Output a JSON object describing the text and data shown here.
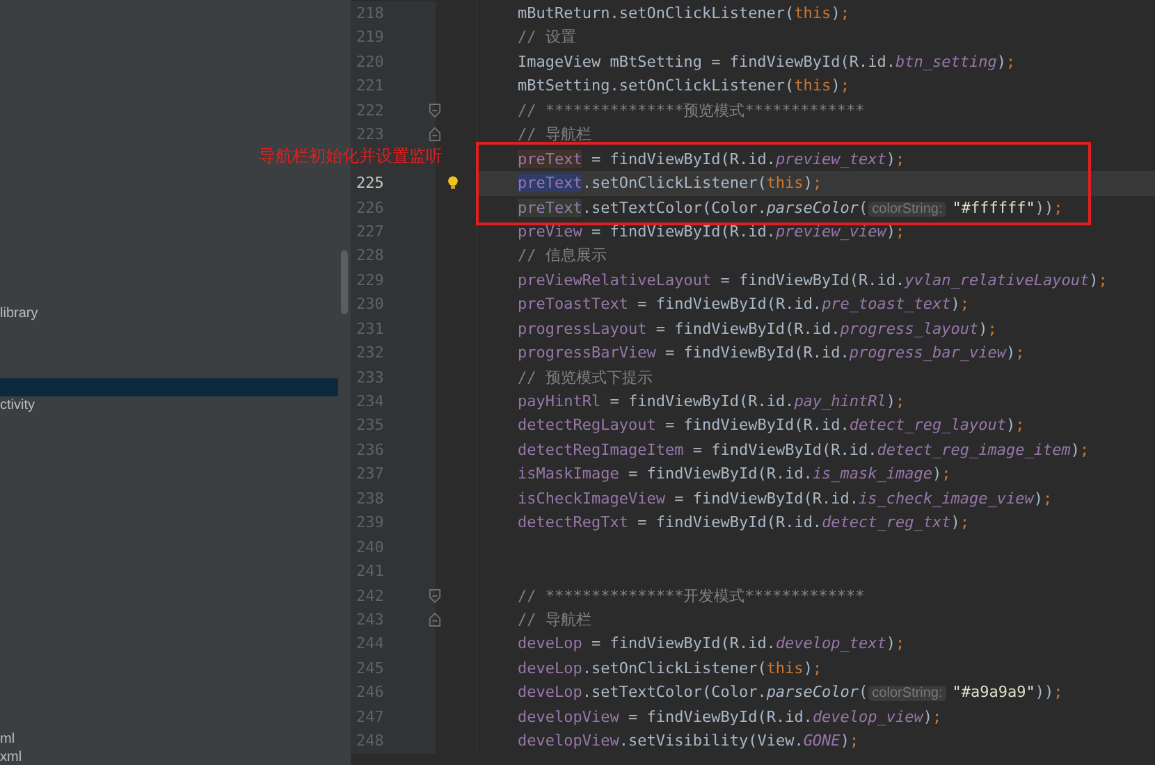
{
  "sidebar": {
    "items": [
      {
        "text": "library",
        "selected": false
      },
      {
        "selected": true
      },
      {
        "text": "ctivity",
        "selected": false
      },
      {
        "text": "ml",
        "selected": false
      },
      {
        "text": "xml",
        "selected": false
      }
    ]
  },
  "editor": {
    "lines": [
      {
        "number": "218",
        "current": false,
        "tokens": [
          {
            "kind": "plain",
            "text": "mButReturn.setOnClickListener("
          },
          {
            "kind": "keyword",
            "text": "this"
          },
          {
            "kind": "plain",
            "text": ")"
          },
          {
            "kind": "keyword",
            "text": ";"
          }
        ]
      },
      {
        "number": "219",
        "current": false,
        "tokens": [
          {
            "kind": "comment",
            "text": "// 设置"
          }
        ]
      },
      {
        "number": "220",
        "current": false,
        "tokens": [
          {
            "kind": "plain",
            "text": "ImageView mBtSetting = findViewById(R.id."
          },
          {
            "kind": "id",
            "text": "btn_setting"
          },
          {
            "kind": "plain",
            "text": ")"
          },
          {
            "kind": "keyword",
            "text": ";"
          }
        ]
      },
      {
        "number": "221",
        "current": false,
        "tokens": [
          {
            "kind": "plain",
            "text": "mBtSetting.setOnClickListener("
          },
          {
            "kind": "keyword",
            "text": "this"
          },
          {
            "kind": "plain",
            "text": ")"
          },
          {
            "kind": "keyword",
            "text": ";"
          }
        ]
      },
      {
        "number": "222",
        "current": false,
        "gutter": [
          {
            "kind": "fold_start"
          }
        ],
        "tokens": [
          {
            "kind": "comment",
            "text": "// ***************预览模式*************"
          }
        ]
      },
      {
        "number": "223",
        "current": false,
        "gutter": [
          {
            "kind": "fold_end"
          }
        ],
        "tokens": [
          {
            "kind": "comment",
            "text": "// 导航栏"
          }
        ]
      },
      {
        "current": false,
        "tokens": [
          {
            "kind": "field_write",
            "text": "preText"
          },
          {
            "kind": "plain",
            "text": " = findViewById(R.id."
          },
          {
            "kind": "id",
            "text": "preview_text"
          },
          {
            "kind": "plain",
            "text": ")"
          },
          {
            "kind": "keyword",
            "text": ";"
          }
        ]
      },
      {
        "number": "225",
        "current": true,
        "gutter": [
          {
            "kind": "bulb"
          }
        ],
        "tokens": [
          {
            "kind": "field_caret",
            "text": "preText"
          },
          {
            "kind": "plain",
            "text": ".setOnClickListener("
          },
          {
            "kind": "keyword",
            "text": "this"
          },
          {
            "kind": "plain",
            "text": ")"
          },
          {
            "kind": "keyword",
            "text": ";"
          }
        ]
      },
      {
        "number": "226",
        "current": false,
        "tokens": [
          {
            "kind": "field_read",
            "text": "preText"
          },
          {
            "kind": "plain",
            "text": ".setTextColor(Color."
          },
          {
            "kind": "method",
            "text": "parseColor"
          },
          {
            "kind": "plain",
            "text": "("
          },
          {
            "kind": "hint",
            "text": "colorString:"
          },
          {
            "kind": "string",
            "text": "\"#ffffff\""
          },
          {
            "kind": "plain",
            "text": "))"
          },
          {
            "kind": "keyword",
            "text": ";"
          }
        ]
      },
      {
        "number": "227",
        "current": false,
        "tokens": [
          {
            "kind": "field",
            "text": "preView"
          },
          {
            "kind": "plain",
            "text": " = findViewById(R.id."
          },
          {
            "kind": "id",
            "text": "preview_view"
          },
          {
            "kind": "plain",
            "text": ")"
          },
          {
            "kind": "keyword",
            "text": ";"
          }
        ]
      },
      {
        "number": "228",
        "current": false,
        "tokens": [
          {
            "kind": "comment",
            "text": "// 信息展示"
          }
        ]
      },
      {
        "number": "229",
        "current": false,
        "tokens": [
          {
            "kind": "field",
            "text": "preViewRelativeLayout"
          },
          {
            "kind": "plain",
            "text": " = findViewById(R.id."
          },
          {
            "kind": "id",
            "text": "yvlan_relativeLayout"
          },
          {
            "kind": "plain",
            "text": ")"
          },
          {
            "kind": "keyword",
            "text": ";"
          }
        ]
      },
      {
        "number": "230",
        "current": false,
        "tokens": [
          {
            "kind": "field",
            "text": "preToastText"
          },
          {
            "kind": "plain",
            "text": " = findViewById(R.id."
          },
          {
            "kind": "id",
            "text": "pre_toast_text"
          },
          {
            "kind": "plain",
            "text": ")"
          },
          {
            "kind": "keyword",
            "text": ";"
          }
        ]
      },
      {
        "number": "231",
        "current": false,
        "tokens": [
          {
            "kind": "field",
            "text": "progressLayout"
          },
          {
            "kind": "plain",
            "text": " = findViewById(R.id."
          },
          {
            "kind": "id",
            "text": "progress_layout"
          },
          {
            "kind": "plain",
            "text": ")"
          },
          {
            "kind": "keyword",
            "text": ";"
          }
        ]
      },
      {
        "number": "232",
        "current": false,
        "tokens": [
          {
            "kind": "field",
            "text": "progressBarView"
          },
          {
            "kind": "plain",
            "text": " = findViewById(R.id."
          },
          {
            "kind": "id",
            "text": "progress_bar_view"
          },
          {
            "kind": "plain",
            "text": ")"
          },
          {
            "kind": "keyword",
            "text": ";"
          }
        ]
      },
      {
        "number": "233",
        "current": false,
        "tokens": [
          {
            "kind": "comment",
            "text": "// 预览模式下提示"
          }
        ]
      },
      {
        "number": "234",
        "current": false,
        "tokens": [
          {
            "kind": "field",
            "text": "payHintRl"
          },
          {
            "kind": "plain",
            "text": " = findViewById(R.id."
          },
          {
            "kind": "id",
            "text": "pay_hintRl"
          },
          {
            "kind": "plain",
            "text": ")"
          },
          {
            "kind": "keyword",
            "text": ";"
          }
        ]
      },
      {
        "number": "235",
        "current": false,
        "tokens": [
          {
            "kind": "field",
            "text": "detectRegLayout"
          },
          {
            "kind": "plain",
            "text": " = findViewById(R.id."
          },
          {
            "kind": "id",
            "text": "detect_reg_layout"
          },
          {
            "kind": "plain",
            "text": ")"
          },
          {
            "kind": "keyword",
            "text": ";"
          }
        ]
      },
      {
        "number": "236",
        "current": false,
        "tokens": [
          {
            "kind": "field",
            "text": "detectRegImageItem"
          },
          {
            "kind": "plain",
            "text": " = findViewById(R.id."
          },
          {
            "kind": "id",
            "text": "detect_reg_image_item"
          },
          {
            "kind": "plain",
            "text": ")"
          },
          {
            "kind": "keyword",
            "text": ";"
          }
        ]
      },
      {
        "number": "237",
        "current": false,
        "tokens": [
          {
            "kind": "field",
            "text": "isMaskImage"
          },
          {
            "kind": "plain",
            "text": " = findViewById(R.id."
          },
          {
            "kind": "id",
            "text": "is_mask_image"
          },
          {
            "kind": "plain",
            "text": ")"
          },
          {
            "kind": "keyword",
            "text": ";"
          }
        ]
      },
      {
        "number": "238",
        "current": false,
        "tokens": [
          {
            "kind": "field",
            "text": "isCheckImageView"
          },
          {
            "kind": "plain",
            "text": " = findViewById(R.id."
          },
          {
            "kind": "id",
            "text": "is_check_image_view"
          },
          {
            "kind": "plain",
            "text": ")"
          },
          {
            "kind": "keyword",
            "text": ";"
          }
        ]
      },
      {
        "number": "239",
        "current": false,
        "tokens": [
          {
            "kind": "field",
            "text": "detectRegTxt"
          },
          {
            "kind": "plain",
            "text": " = findViewById(R.id."
          },
          {
            "kind": "id",
            "text": "detect_reg_txt"
          },
          {
            "kind": "plain",
            "text": ")"
          },
          {
            "kind": "keyword",
            "text": ";"
          }
        ]
      },
      {
        "number": "240",
        "current": false
      },
      {
        "number": "241",
        "current": false
      },
      {
        "number": "242",
        "current": false,
        "gutter": [
          {
            "kind": "fold_start"
          }
        ],
        "tokens": [
          {
            "kind": "comment",
            "text": "// ***************开发模式*************"
          }
        ]
      },
      {
        "number": "243",
        "current": false,
        "gutter": [
          {
            "kind": "fold_end"
          }
        ],
        "tokens": [
          {
            "kind": "comment",
            "text": "// 导航栏"
          }
        ]
      },
      {
        "number": "244",
        "current": false,
        "tokens": [
          {
            "kind": "field",
            "text": "deveLop"
          },
          {
            "kind": "plain",
            "text": " = findViewById(R.id."
          },
          {
            "kind": "id",
            "text": "develop_text"
          },
          {
            "kind": "plain",
            "text": ")"
          },
          {
            "kind": "keyword",
            "text": ";"
          }
        ]
      },
      {
        "number": "245",
        "current": false,
        "tokens": [
          {
            "kind": "field",
            "text": "deveLop"
          },
          {
            "kind": "plain",
            "text": ".setOnClickListener("
          },
          {
            "kind": "keyword",
            "text": "this"
          },
          {
            "kind": "plain",
            "text": ")"
          },
          {
            "kind": "keyword",
            "text": ";"
          }
        ]
      },
      {
        "number": "246",
        "current": false,
        "tokens": [
          {
            "kind": "field",
            "text": "deveLop"
          },
          {
            "kind": "plain",
            "text": ".setTextColor(Color."
          },
          {
            "kind": "method",
            "text": "parseColor"
          },
          {
            "kind": "plain",
            "text": "("
          },
          {
            "kind": "hint",
            "text": "colorString:"
          },
          {
            "kind": "string",
            "text": "\"#a9a9a9\""
          },
          {
            "kind": "plain",
            "text": "))"
          },
          {
            "kind": "keyword",
            "text": ";"
          }
        ]
      },
      {
        "number": "247",
        "current": false,
        "tokens": [
          {
            "kind": "field",
            "text": "developView"
          },
          {
            "kind": "plain",
            "text": " = findViewById(R.id."
          },
          {
            "kind": "id",
            "text": "develop_view"
          },
          {
            "kind": "plain",
            "text": ")"
          },
          {
            "kind": "keyword",
            "text": ";"
          }
        ]
      },
      {
        "number": "248",
        "current": false,
        "tokens": [
          {
            "kind": "field",
            "text": "developView"
          },
          {
            "kind": "plain",
            "text": ".setVisibility(View."
          },
          {
            "kind": "static",
            "text": "GONE"
          },
          {
            "kind": "plain",
            "text": ")"
          },
          {
            "kind": "keyword",
            "text": ";"
          }
        ]
      }
    ]
  },
  "annotation": {
    "text": "导航栏初始化并设置监听"
  }
}
